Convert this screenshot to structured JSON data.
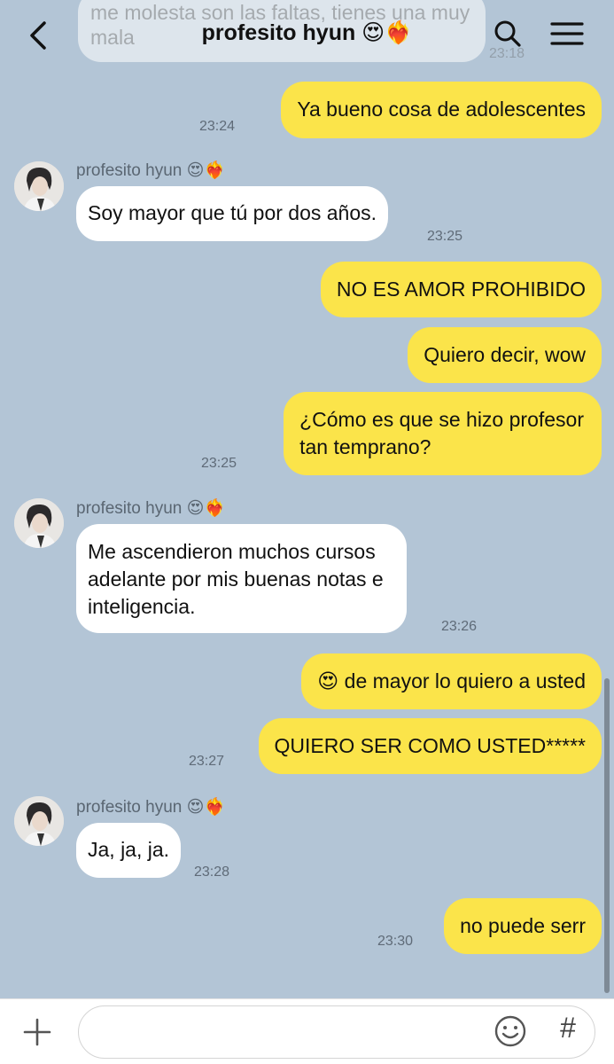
{
  "header": {
    "title": "profesito hyun 😍❤️‍🔥",
    "ghost_text": "me molesta son las faltas, tienes una muy mala",
    "ghost_time": "23:18"
  },
  "messages": [
    {
      "side": "out",
      "text": "Ya bueno cosa de adolescentes",
      "time": "23:24"
    },
    {
      "side": "in",
      "sender": "profesito hyun 😍❤️‍🔥",
      "text": "Soy mayor que tú por dos años.",
      "time": "23:25"
    },
    {
      "side": "out",
      "text": "NO ES AMOR PROHIBIDO"
    },
    {
      "side": "out",
      "text": "Quiero decir, wow"
    },
    {
      "side": "out",
      "lines": [
        "¿Cómo es que se hizo profesor",
        "tan temprano?"
      ],
      "time": "23:25"
    },
    {
      "side": "in",
      "sender": "profesito hyun 😍❤️‍🔥",
      "lines": [
        "Me ascendieron muchos cursos",
        "adelante por mis buenas notas e",
        "inteligencia."
      ],
      "time": "23:26"
    },
    {
      "side": "out",
      "text": "😍 de mayor lo quiero a usted"
    },
    {
      "side": "out",
      "text": "QUIERO SER COMO USTED*****",
      "time": "23:27"
    },
    {
      "side": "in",
      "sender": "profesito hyun 😍❤️‍🔥",
      "text": "Ja, ja, ja.",
      "time": "23:28"
    },
    {
      "side": "out",
      "text": "no puede serr",
      "time": "23:30"
    }
  ],
  "icons": {
    "back": "chevron-left-icon",
    "search": "search-icon",
    "menu": "hamburger-menu-icon",
    "plus": "plus-icon",
    "emoji": "smiley-icon",
    "hashtag": "hashtag-icon"
  },
  "colors": {
    "background": "#b3c5d6",
    "outgoing_bubble": "#fbe44a",
    "incoming_bubble": "#ffffff"
  },
  "input": {
    "placeholder": ""
  },
  "hash_label": "#"
}
